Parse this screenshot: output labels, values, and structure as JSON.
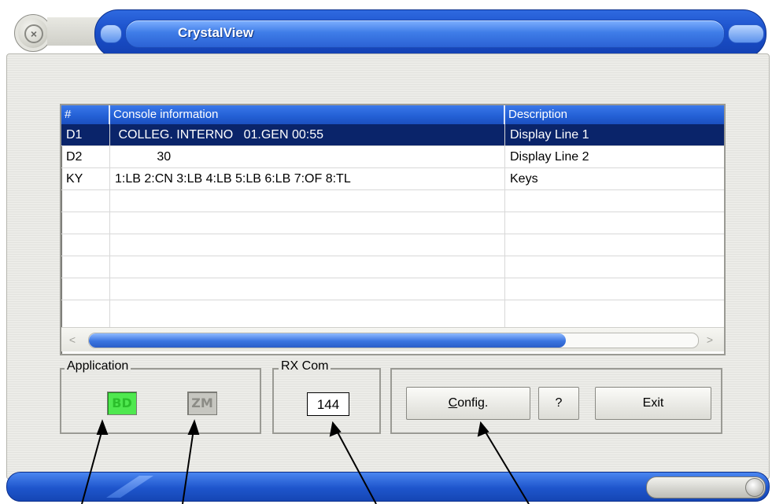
{
  "window": {
    "title": "CrystalView"
  },
  "list": {
    "columns": [
      "#",
      "Console information",
      "Description"
    ],
    "rows": [
      {
        "id": "D1",
        "info": " COLLEG. INTERNO   01.GEN 00:55",
        "desc": "Display Line 1",
        "selected": true
      },
      {
        "id": "D2",
        "info": "            30",
        "desc": "Display Line 2",
        "selected": false
      },
      {
        "id": "KY",
        "info": "1:LB 2:CN 3:LB 4:LB 5:LB 6:LB 7:OF 8:TL",
        "desc": "Keys",
        "selected": false
      }
    ]
  },
  "application": {
    "label": "Application",
    "bd": "BD",
    "zm": "ZM",
    "active_color": "#4fe84f",
    "inactive_color": "#c6c6c0"
  },
  "rx": {
    "label": "RX Com",
    "value": "144"
  },
  "buttons": {
    "config": "Config.",
    "help": "?",
    "exit": "Exit"
  },
  "colors": {
    "title_blue": "#2461d6",
    "selection": "#0a246a"
  }
}
